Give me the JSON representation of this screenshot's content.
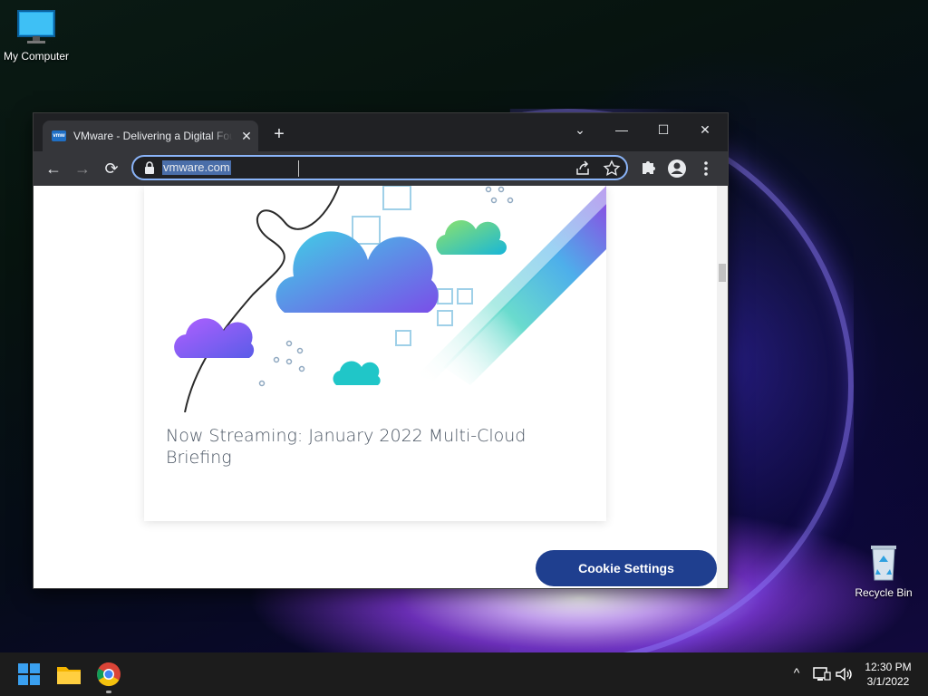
{
  "desktop": {
    "icons": [
      {
        "label": "My Computer",
        "icon": "monitor-icon"
      },
      {
        "label": "Recycle Bin",
        "icon": "recycle-bin-icon"
      }
    ]
  },
  "browser": {
    "tab": {
      "title": "VMware - Delivering a Digital Foundation",
      "favicon": "vmw",
      "close": "✕"
    },
    "new_tab": "+",
    "window_controls": {
      "dropdown": "⌄",
      "minimize": "—",
      "maximize": "☐",
      "close": "✕"
    },
    "nav": {
      "back": "←",
      "forward": "→",
      "reload": "⟳"
    },
    "address": {
      "url": "vmware.com"
    },
    "toolbar_icons": [
      "share-icon",
      "star-icon",
      "extensions-icon",
      "profile-icon",
      "menu-icon"
    ]
  },
  "page": {
    "card_title": "Now Streaming: January 2022 Multi-Cloud Briefing",
    "cookie_button": "Cookie Settings"
  },
  "taskbar": {
    "apps": [
      "start-icon",
      "file-explorer-icon",
      "chrome-icon"
    ],
    "tray": {
      "chevron": "^"
    },
    "clock": {
      "time": "12:30 PM",
      "date": "3/1/2022"
    }
  },
  "colors": {
    "accent": "#8ab4f8",
    "cookie_button": "#1f3f8f",
    "chrome_dark": "#202124",
    "chrome_toolbar": "#35363a"
  }
}
